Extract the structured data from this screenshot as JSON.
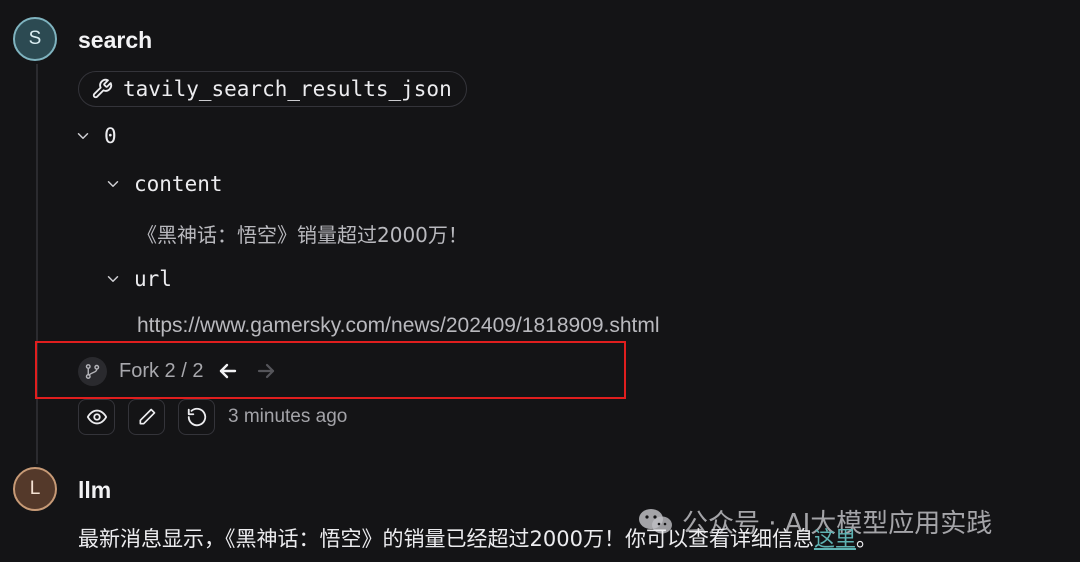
{
  "messages": [
    {
      "avatar_letter": "S",
      "sender": "search",
      "tool_name": "tavily_search_results_json",
      "tree": {
        "index_label": "0",
        "content_key": "content",
        "content_value": "《黑神话：悟空》销量超过2000万！",
        "url_key": "url",
        "url_value": "https://www.gamersky.com/news/202409/1818909.shtml"
      },
      "fork": {
        "label": "Fork 2 / 2",
        "current": 2,
        "total": 2
      },
      "timestamp": "3 minutes ago"
    },
    {
      "avatar_letter": "L",
      "sender": "llm",
      "text_before_link": "最新消息显示，《黑神话：悟空》的销量已经超过2000万！你可以查看详细信息",
      "link_text": "这里",
      "text_after_link": "。"
    }
  ],
  "watermark": {
    "text": "公众号 · AI大模型应用实践",
    "icon": "wechat-icon"
  },
  "colors": {
    "background": "#141416",
    "highlight": "#e01e1e",
    "link": "#5fb3b3",
    "avatar_s": "#2c4a52",
    "avatar_l": "#54392a"
  },
  "icons": {
    "tool": "wrench-icon",
    "expand": "chevron-down-icon",
    "fork": "git-fork-icon",
    "prev": "arrow-left-icon",
    "next": "arrow-right-icon",
    "view": "eye-icon",
    "edit": "pencil-icon",
    "rerun": "refresh-icon"
  }
}
